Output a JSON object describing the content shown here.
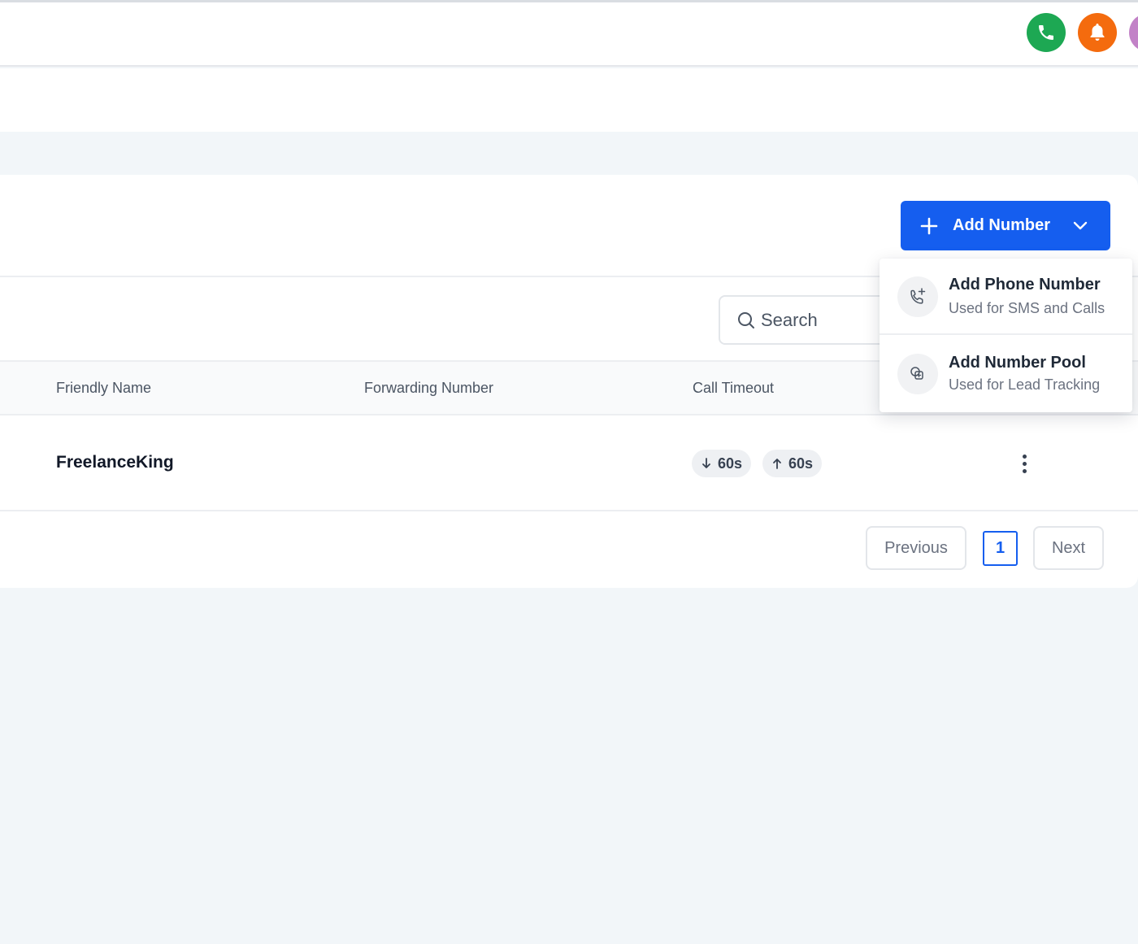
{
  "topbar": {
    "icons": [
      "phone-icon",
      "bell-icon",
      "user-avatar"
    ],
    "colors": {
      "call": "#1da853",
      "notifications": "#f46b0e",
      "avatar": "#c282c7"
    }
  },
  "toolbar": {
    "add_number_label": "Add Number",
    "accent": "#155eef"
  },
  "add_menu": {
    "items": [
      {
        "title": "Add Phone Number",
        "subtitle": "Used for SMS and Calls",
        "icon": "phone-plus-icon"
      },
      {
        "title": "Add Number Pool",
        "subtitle": "Used for Lead Tracking",
        "icon": "number-pool-icon"
      }
    ]
  },
  "search": {
    "placeholder": "Search"
  },
  "table": {
    "columns": [
      "Friendly Name",
      "Forwarding Number",
      "Call Timeout"
    ],
    "rows": [
      {
        "friendly_name": "FreelanceKing",
        "forwarding_number": "",
        "timeout_inbound": "60s",
        "timeout_outbound": "60s"
      }
    ]
  },
  "pagination": {
    "previous": "Previous",
    "current": "1",
    "next": "Next"
  }
}
